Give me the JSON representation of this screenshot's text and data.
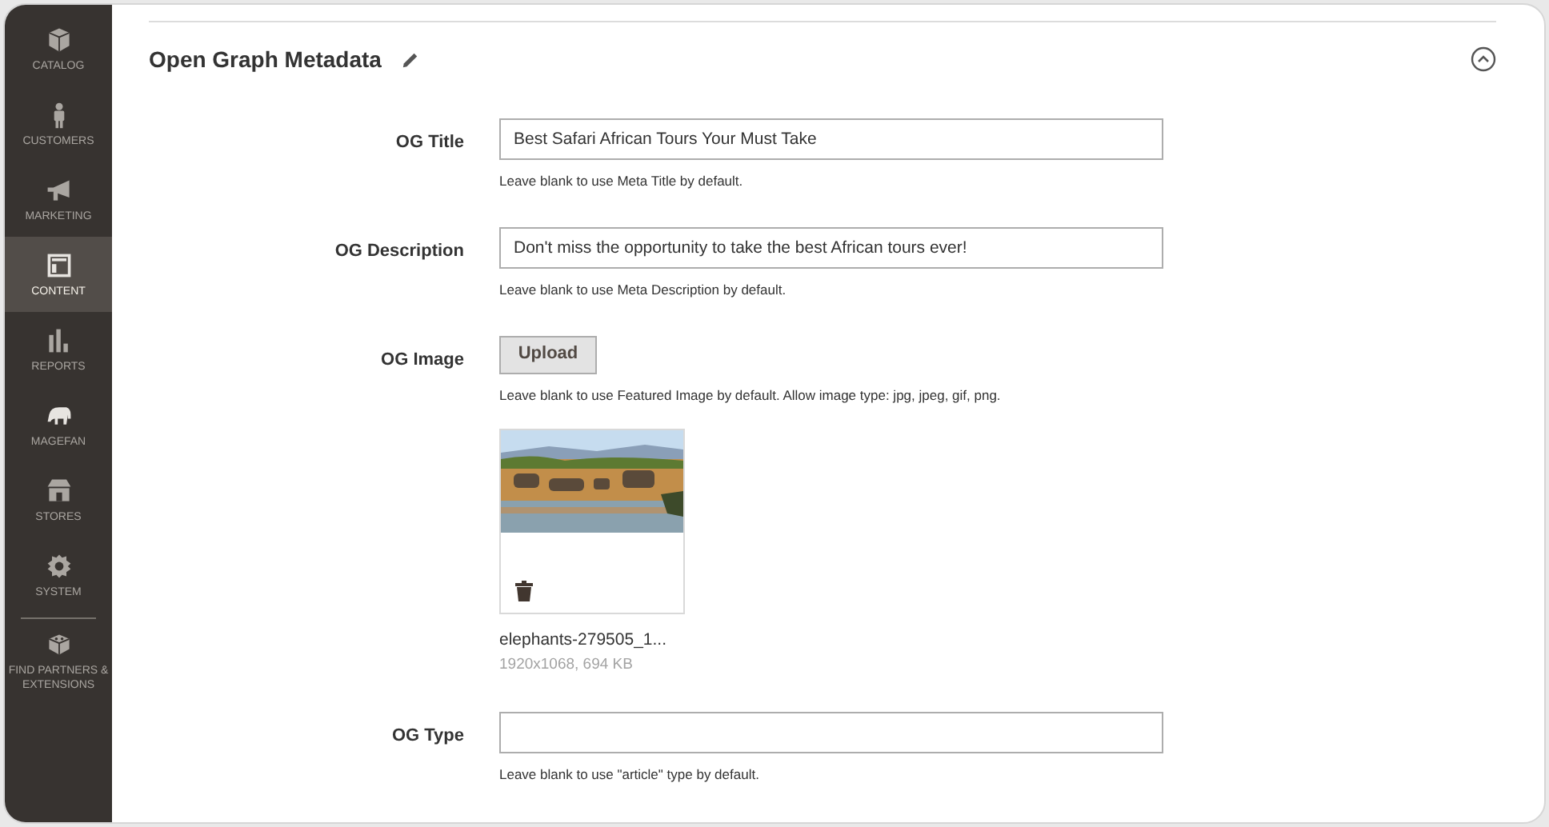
{
  "sidebar": {
    "items": [
      {
        "label": "CATALOG",
        "selected": false
      },
      {
        "label": "CUSTOMERS",
        "selected": false
      },
      {
        "label": "MARKETING",
        "selected": false
      },
      {
        "label": "CONTENT",
        "selected": true
      },
      {
        "label": "REPORTS",
        "selected": false
      },
      {
        "label": "MAGEFAN",
        "selected": false
      },
      {
        "label": "STORES",
        "selected": false
      },
      {
        "label": "SYSTEM",
        "selected": false
      },
      {
        "label": "FIND PARTNERS & EXTENSIONS",
        "selected": false
      }
    ]
  },
  "section": {
    "title": "Open Graph Metadata",
    "expanded": true,
    "fields": [
      {
        "kind": "text",
        "label": "OG Title",
        "value": "Best Safari African Tours Your Must Take",
        "hint": "Leave blank to use Meta Title by default."
      },
      {
        "kind": "text",
        "label": "OG Description",
        "value": "Don't miss the opportunity to take the best African tours ever!",
        "hint": "Leave blank to use Meta Description by default."
      },
      {
        "label": "OG Image",
        "button": "Upload",
        "hint": "Leave blank to use Featured Image by default. Allow image type: jpg, jpeg, gif, png.",
        "file": {
          "name": "elephants-279505_1...",
          "meta": "1920x1068, 694 KB"
        }
      },
      {
        "kind": "text",
        "label": "OG Type",
        "hint": "Leave blank to use \"article\" type by default."
      }
    ]
  }
}
